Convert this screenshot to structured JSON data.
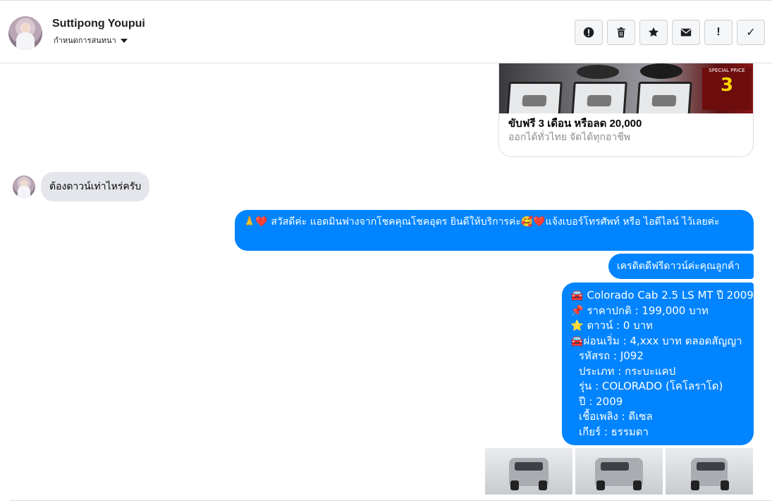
{
  "header": {
    "contact_name": "Suttipong Youpui",
    "contact_sub": "กำหนดการสนทนา",
    "actions": [
      {
        "icon": "alert-circle-icon",
        "glyph": "!"
      },
      {
        "icon": "trash-icon"
      },
      {
        "icon": "star-icon"
      },
      {
        "icon": "envelope-icon"
      },
      {
        "icon": "exclamation-icon",
        "glyph": "!"
      },
      {
        "icon": "check-icon",
        "glyph": "✓"
      }
    ]
  },
  "card": {
    "title": "ขับฟรี 3 เดือน หรือลด 20,000",
    "subtitle": "ออกได้ทั่วไทย จัดได้ทุกอาชีพ",
    "promo_small": "SPECIAL PRICE",
    "promo_big": "3"
  },
  "messages": {
    "incoming_1": "ต้องดาวน์เท่าไหร่ครับ",
    "outgoing_1": "🙏❤️ สวัสดีค่ะ แอดมินฟางจากโชคคุณโชคอุดร ยินดีให้บริการค่ะ🥰❤️แจ้งเบอร์โทรศัพท์ หรือ ไอดีไลน์  ไว้เลยค่ะ",
    "outgoing_2": "เครดิตดีฟรีดาวน์ค่ะคุณลูกค้า",
    "outgoing_3_lines": [
      "🚘 Colorado Cab 2.5 LS MT ปี 2009",
      "📌 ราคาปกติ : 199,000 บาท",
      "⭐ ดาวน์ : 0 บาท",
      "🚘ผ่อนเริ่ม : 4,xxx บาท ตลอดสัญญา",
      "รหัสรถ : J092",
      "ประเภท : กระบะแคป",
      "รุ่น : COLORADO (โคโลราโด)",
      "ปี : 2009",
      "เชื้อเพลิง : ดีเซล",
      "เกียร์ : ธรรมดา"
    ]
  },
  "colors": {
    "outgoing_bubble": "#0084ff",
    "incoming_bubble": "#e4e6eb",
    "border": "#dadde1"
  }
}
